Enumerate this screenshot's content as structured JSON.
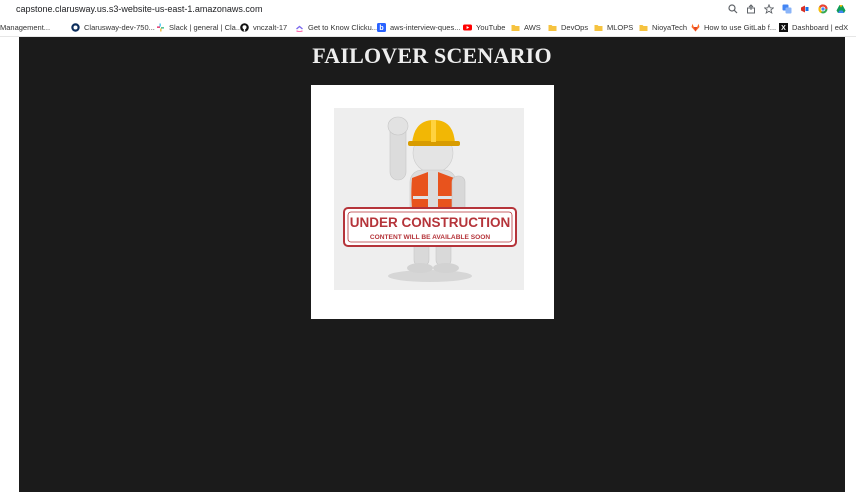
{
  "browser": {
    "url": "capstone.clarusway.us.s3-website-us-east-1.amazonaws.com",
    "bookmarks": [
      {
        "label": "Management...",
        "icon": "none"
      },
      {
        "label": "Clarusway-dev-750...",
        "icon": "clarusway-icon"
      },
      {
        "label": "Slack | general | Cla...",
        "icon": "slack-icon"
      },
      {
        "label": "vnczalt-17",
        "icon": "github-icon"
      },
      {
        "label": "Get to Know Clicku...",
        "icon": "clickup-icon"
      },
      {
        "label": "aws-interview-ques...",
        "icon": "blog-icon"
      },
      {
        "label": "YouTube",
        "icon": "youtube-icon"
      },
      {
        "label": "AWS",
        "icon": "folder-icon"
      },
      {
        "label": "DevOps",
        "icon": "folder-icon"
      },
      {
        "label": "MLOPS",
        "icon": "folder-icon"
      },
      {
        "label": "NioyaTech",
        "icon": "folder-icon"
      },
      {
        "label": "How to use GitLab f...",
        "icon": "gitlab-icon"
      },
      {
        "label": "Dashboard | edX",
        "icon": "edx-icon"
      }
    ]
  },
  "page": {
    "title": "FAILOVER SCENARIO",
    "image": {
      "banner_line1": "UNDER CONSTRUCTION",
      "banner_line2": "CONTENT WILL BE AVAILABLE SOON"
    }
  },
  "colors": {
    "page_background": "#1b1b1b",
    "title_text": "#eeeeee",
    "banner_red": "#b5343a",
    "helmet_yellow": "#f2b705",
    "vest_orange": "#e8531d"
  }
}
